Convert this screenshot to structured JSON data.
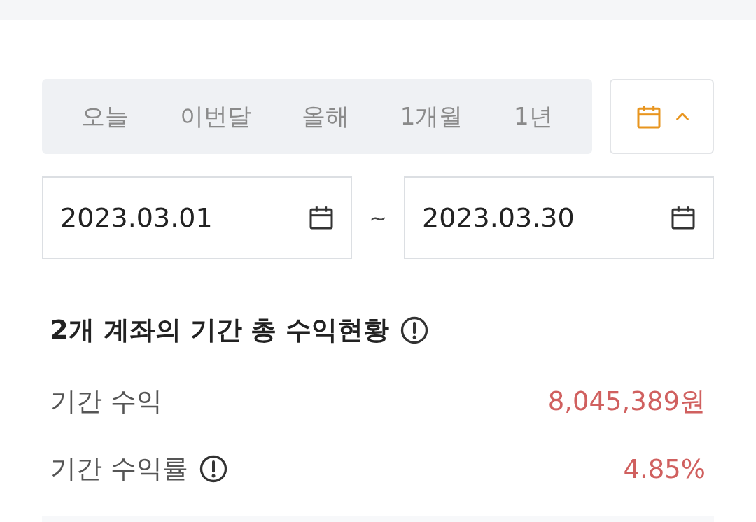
{
  "period_tabs": [
    {
      "label": "오늘",
      "selected": false
    },
    {
      "label": "이번달",
      "selected": false
    },
    {
      "label": "올해",
      "selected": false
    },
    {
      "label": "1개월",
      "selected": false
    },
    {
      "label": "1년",
      "selected": false
    }
  ],
  "calendar_toggle": {
    "expanded": true
  },
  "date_range": {
    "start": "2023.03.01",
    "separator": "~",
    "end": "2023.03.30"
  },
  "summary": {
    "title": "2개 계좌의 기간 총 수익현황",
    "rows": [
      {
        "label": "기간 수익",
        "info": false,
        "value": "8,045,389원"
      },
      {
        "label": "기간 수익률",
        "info": true,
        "value": "4.85%"
      }
    ]
  }
}
